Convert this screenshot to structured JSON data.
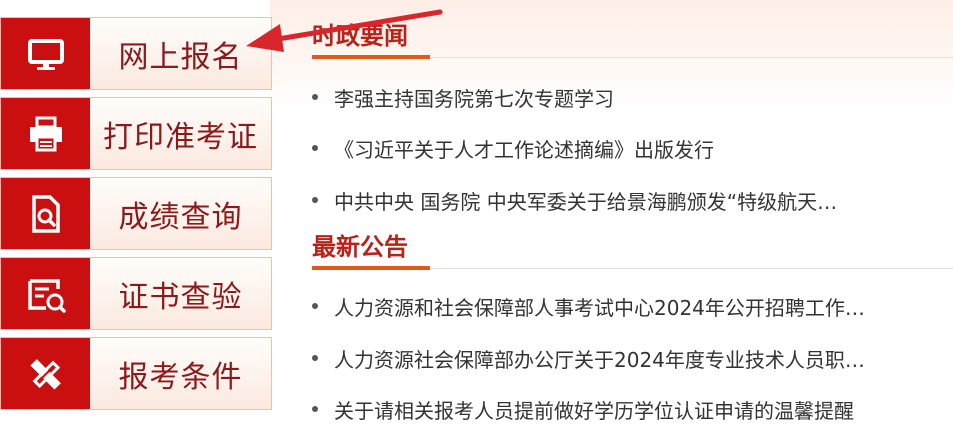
{
  "menu": {
    "items": [
      {
        "label": "网上报名",
        "icon": "monitor-icon"
      },
      {
        "label": "打印准考证",
        "icon": "printer-icon"
      },
      {
        "label": "成绩查询",
        "icon": "search-document-icon"
      },
      {
        "label": "证书查验",
        "icon": "certificate-search-icon"
      },
      {
        "label": "报考条件",
        "icon": "ruler-pencil-icon"
      }
    ]
  },
  "news": {
    "title": "时政要闻",
    "items": [
      "李强主持国务院第七次专题学习",
      "《习近平关于人才工作论述摘编》出版发行",
      "中共中央 国务院 中央军委关于给景海鹏颁发“特级航天…"
    ]
  },
  "notices": {
    "title": "最新公告",
    "items": [
      "人力资源和社会保障部人事考试中心2024年公开招聘工作…",
      "人力资源社会保障部办公厅关于2024年度专业技术人员职…",
      "关于请相关报考人员提前做好学历学位认证申请的温馨提醒"
    ]
  },
  "colors": {
    "icon_bg": "#c90f0f",
    "accent": "#e15a17",
    "title": "#b7221a",
    "annotation_arrow": "#d9262c"
  }
}
